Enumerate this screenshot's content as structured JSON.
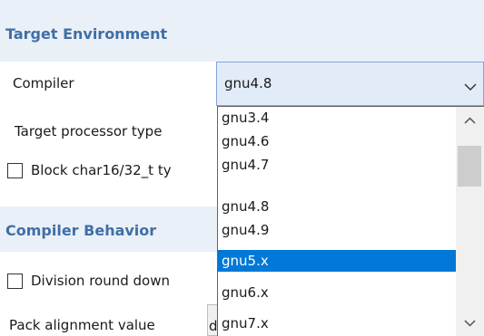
{
  "sections": {
    "target_environment": "Target Environment",
    "compiler_behavior": "Compiler Behavior"
  },
  "fields": {
    "compiler_label": "Compiler",
    "target_processor_label": "Target processor type",
    "block_char_label": "Block char16/32_t ty",
    "division_round_label": "Division round down",
    "pack_alignment_label": "Pack alignment value",
    "pack_alignment_value": "d"
  },
  "compiler_select": {
    "selected": "gnu4.8",
    "options": [
      "gnu3.4",
      "gnu4.6",
      "gnu4.7",
      "gnu4.8",
      "gnu4.9",
      "gnu5.x",
      "gnu6.x",
      "gnu7.x"
    ],
    "highlighted": "gnu5.x",
    "icon": "chevron-down-icon"
  },
  "colors": {
    "section_header_bg": "#eaf0f8",
    "section_header_text": "#3f6fa6",
    "combo_bg": "#e2ecf9",
    "combo_border": "#7ea6d6",
    "selection": "#0078d7"
  }
}
